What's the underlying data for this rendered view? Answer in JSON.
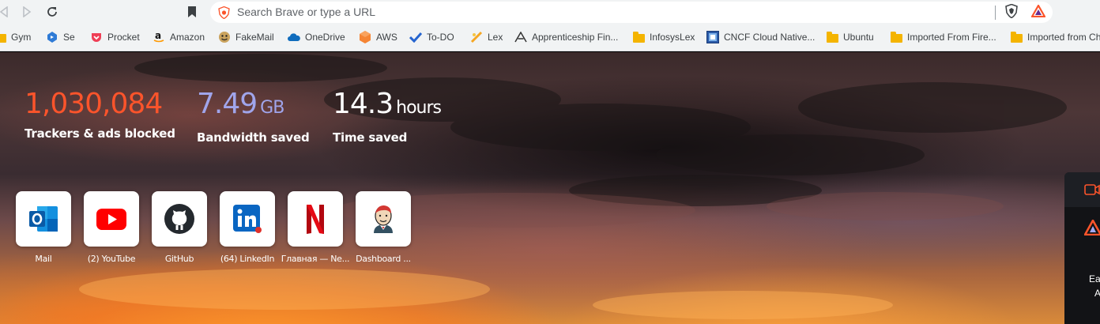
{
  "toolbar": {
    "search_placeholder": "Search Brave or type a URL"
  },
  "bookmarks": [
    {
      "label": "Gym",
      "icon": "folder-icon"
    },
    {
      "label": "Se",
      "icon": "azure-devops-icon"
    },
    {
      "label": "Procket",
      "icon": "pocket-icon"
    },
    {
      "label": "Amazon",
      "icon": "amazon-icon"
    },
    {
      "label": "FakeMail",
      "icon": "fakemail-icon"
    },
    {
      "label": "OneDrive",
      "icon": "onedrive-icon"
    },
    {
      "label": "AWS",
      "icon": "aws-icon"
    },
    {
      "label": "To-DO",
      "icon": "todo-icon"
    },
    {
      "label": "Lex",
      "icon": "lex-icon"
    },
    {
      "label": "Apprenticeship Fin...",
      "icon": "apprenticeship-icon"
    },
    {
      "label": "InfosysLex",
      "icon": "folder-icon"
    },
    {
      "label": "CNCF Cloud Native...",
      "icon": "cncf-icon"
    },
    {
      "label": "Ubuntu",
      "icon": "folder-icon"
    },
    {
      "label": "Imported From Fire...",
      "icon": "folder-icon"
    },
    {
      "label": "Imported from Ch",
      "icon": "folder-icon"
    }
  ],
  "stats": {
    "trackers": {
      "value": "1,030,084",
      "label": "Trackers & ads blocked",
      "color": "#fb542b"
    },
    "bandwidth": {
      "value": "7.49",
      "unit": "GB",
      "label": "Bandwidth saved",
      "color": "#a0a5eb"
    },
    "time": {
      "value": "14.3",
      "unit": "hours",
      "label": "Time saved",
      "color": "#ffffff"
    }
  },
  "top_sites": [
    {
      "label": "Mail",
      "icon": "outlook-icon"
    },
    {
      "label": "(2) YouTube",
      "icon": "youtube-icon"
    },
    {
      "label": "GitHub",
      "icon": "github-icon"
    },
    {
      "label": "(64) LinkedIn",
      "icon": "linkedin-icon"
    },
    {
      "label": "Главная — Ne...",
      "icon": "netflix-icon"
    },
    {
      "label": "Dashboard ...",
      "icon": "jenkins-icon"
    }
  ],
  "side_panel": {
    "text_line1": "Ea",
    "text_line2": "A"
  },
  "colors": {
    "brave_orange": "#fb542b",
    "toolbar_bg": "#f1f3f4"
  }
}
